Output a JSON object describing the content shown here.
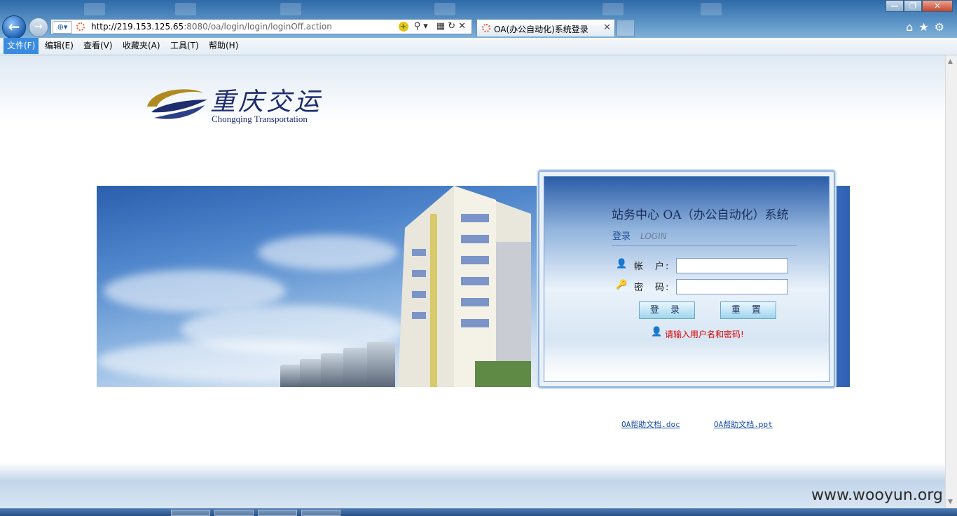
{
  "browser": {
    "url_host": "http://219.153.125.65",
    "url_path": ":8080/oa/login/login/loginOff.action",
    "tab_title": "OA(办公自动化)系统登录"
  },
  "menu": [
    "文件(F)",
    "编辑(E)",
    "查看(V)",
    "收藏夹(A)",
    "工具(T)",
    "帮助(H)"
  ],
  "logo": {
    "cn": "重庆交运",
    "en": "Chongqing Transportation"
  },
  "login": {
    "title": "站务中心 OA（办公自动化）系统",
    "sub_cn": "登录",
    "sub_en": "LOGIN",
    "account_label": "帐　户:",
    "password_label": "密　码:",
    "account_value": "",
    "password_value": "",
    "login_button": "登 录",
    "reset_button": "重 置",
    "message": "请输入用户名和密码!"
  },
  "links": {
    "doc": "OA帮助文档.doc",
    "ppt": "OA帮助文档.ppt"
  },
  "watermark": "www.wooyun.org",
  "colors": {
    "accent": "#3a8be0",
    "error": "#dd0000",
    "link": "#1a4fa8"
  }
}
